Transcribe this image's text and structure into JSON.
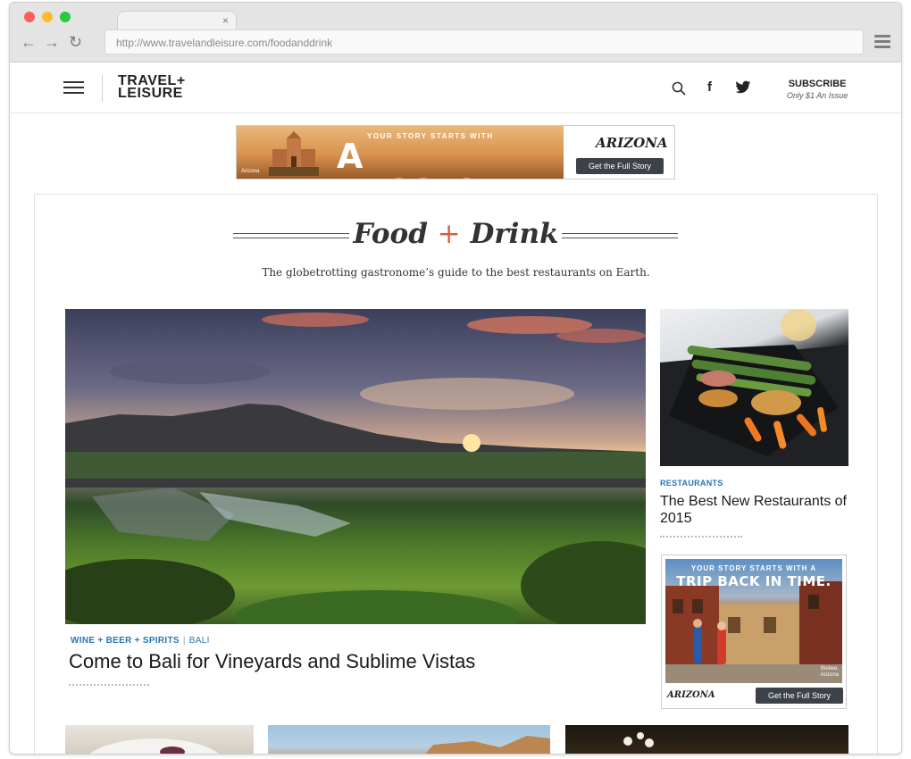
{
  "browser": {
    "url": "http://www.travelandleisure.com/foodanddrink",
    "tab_close": "×"
  },
  "header": {
    "logo_line1": "TRAVEL+",
    "logo_line2": "LEISURE",
    "facebook_glyph": "f",
    "subscribe": "SUBSCRIBE",
    "subscribe_sub": "Only $1 An Issue"
  },
  "ad_top": {
    "small_line": "YOUR STORY STARTS WITH",
    "headline": "A MISSION.",
    "credit": "Arizona",
    "brand": "ARIZONA",
    "cta": "Get the Full Story"
  },
  "section": {
    "title_left": "Food",
    "title_plus": "+",
    "title_right": "Drink",
    "tagline": "The globetrotting gastronome’s guide to the best restaurants on Earth."
  },
  "hero": {
    "category": "WINE + BEER + SPIRITS",
    "separator": "|",
    "location": "BALI",
    "title": "Come to Bali for Vineyards and Sublime Vistas"
  },
  "side_story": {
    "category": "RESTAURANTS",
    "title": "The Best New Restaurants of 2015"
  },
  "side_ad": {
    "line1": "YOUR STORY STARTS WITH A",
    "line2": "TRIP BACK IN TIME.",
    "credit_line1": "Bisbee,",
    "credit_line2": "Arizona",
    "brand": "ARIZONA",
    "cta": "Get the Full Story"
  },
  "colors": {
    "accent_blue": "#2a77b5",
    "plus_orange": "#e05a3b",
    "cta_dark": "#3c4248"
  }
}
